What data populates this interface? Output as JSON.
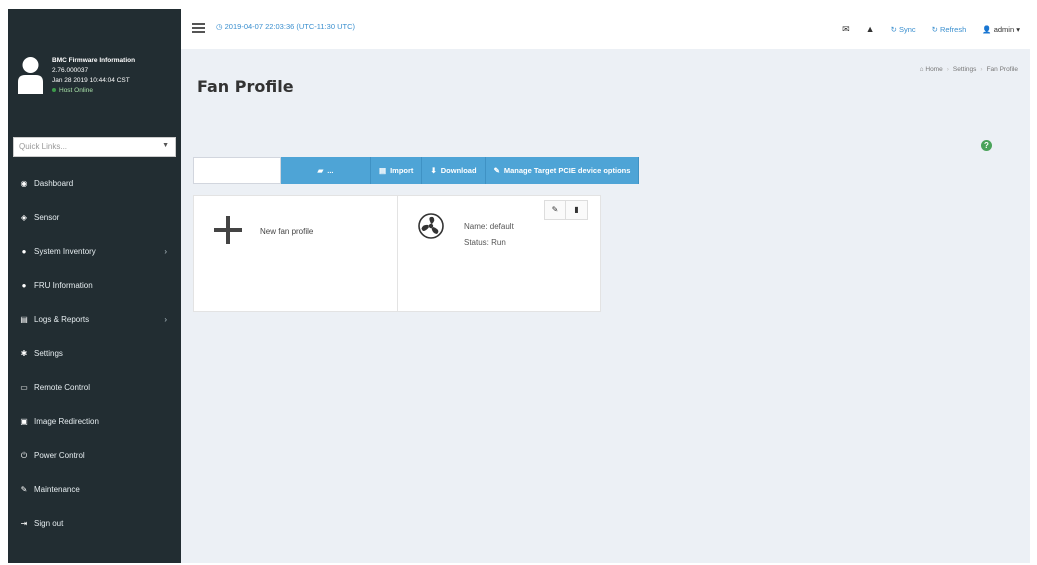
{
  "header": {
    "datetime": "2019-04-07 22:03:36 (UTC-11:30 UTC)",
    "sync_label": "Sync",
    "refresh_label": "Refresh",
    "user_label": "admin"
  },
  "user_panel": {
    "title": "BMC Firmware Information",
    "version": "2.76.000037",
    "build_date": "Jan 28 2019 10:44:04 CST",
    "status": "Host Online"
  },
  "quicklinks": {
    "placeholder": "Quick Links..."
  },
  "sidebar": {
    "items": [
      {
        "label": "Dashboard",
        "icon": "dashboard-icon",
        "glyph": "◉",
        "arrow": ""
      },
      {
        "label": "Sensor",
        "icon": "sensor-icon",
        "glyph": "◈",
        "arrow": ""
      },
      {
        "label": "System Inventory",
        "icon": "info-icon",
        "glyph": "●",
        "arrow": "›"
      },
      {
        "label": "FRU Information",
        "icon": "info-icon",
        "glyph": "●",
        "arrow": ""
      },
      {
        "label": "Logs & Reports",
        "icon": "chart-icon",
        "glyph": "▤",
        "arrow": "›"
      },
      {
        "label": "Settings",
        "icon": "gear-icon",
        "glyph": "✱",
        "arrow": ""
      },
      {
        "label": "Remote Control",
        "icon": "monitor-icon",
        "glyph": "▭",
        "arrow": ""
      },
      {
        "label": "Image Redirection",
        "icon": "disk-icon",
        "glyph": "▣",
        "arrow": ""
      },
      {
        "label": "Power Control",
        "icon": "power-icon",
        "glyph": "⏻",
        "arrow": ""
      },
      {
        "label": "Maintenance",
        "icon": "wrench-icon",
        "glyph": "✎",
        "arrow": ""
      },
      {
        "label": "Sign out",
        "icon": "sign-out-icon",
        "glyph": "⇥",
        "arrow": ""
      }
    ]
  },
  "page": {
    "title": "Fan Profile",
    "breadcrumb": [
      "Home",
      "Settings",
      "Fan Profile"
    ]
  },
  "toolbar": {
    "folder_label": "...",
    "import_label": "Import",
    "download_label": "Download",
    "manage_label": "Manage Target PCIE device options"
  },
  "cards": {
    "new_label": "New fan profile",
    "profile_name": "Name: default",
    "profile_status": "Status: Run"
  },
  "colors": {
    "sidebar_bg": "#222d32",
    "accent_blue": "#4ea4d6",
    "online_green": "#3c9a4a",
    "content_bg": "#ecf0f5"
  }
}
